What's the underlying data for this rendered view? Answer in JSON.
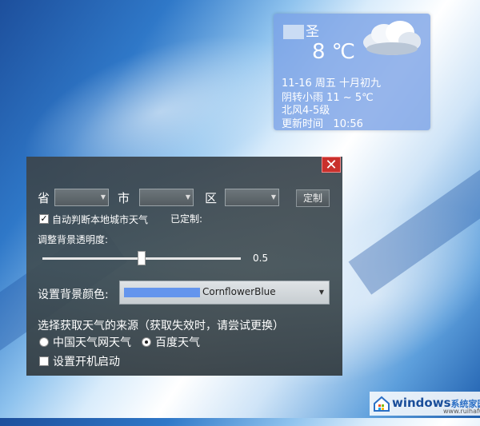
{
  "weather": {
    "city_suffix": "圣",
    "temperature": "8 ℃",
    "date_line": "11-16   周五   十月初九",
    "condition_line": "阴转小雨   11 ~ 5℃",
    "wind_line": "北风4-5级",
    "update_label": "更新时间",
    "update_time": "10:56",
    "icon": "cloud-icon"
  },
  "dialog": {
    "close_icon": "close-icon",
    "province_label": "省",
    "city_label": "市",
    "district_label": "区",
    "customize_button": "定制",
    "auto_detect_label": "自动判断本地城市天气",
    "auto_detect_checked": true,
    "customized_label": "已定制:",
    "opacity_label": "调整背景透明度:",
    "opacity_value": "0.5",
    "opacity": 0.5,
    "bg_color_label": "设置背景颜色:",
    "bg_color_name": "CornflowerBlue",
    "bg_color_hex": "#6495ED",
    "source_label": "选择获取天气的来源（获取失效时，请尝试更换）",
    "sources": [
      {
        "label": "中国天气网天气",
        "selected": false
      },
      {
        "label": "百度天气",
        "selected": true
      }
    ],
    "startup_label": "设置开机启动",
    "startup_checked": false
  },
  "watermark": {
    "brand": "windows",
    "brand_sub": "系统家园",
    "url": "www.ruihafu.com"
  }
}
